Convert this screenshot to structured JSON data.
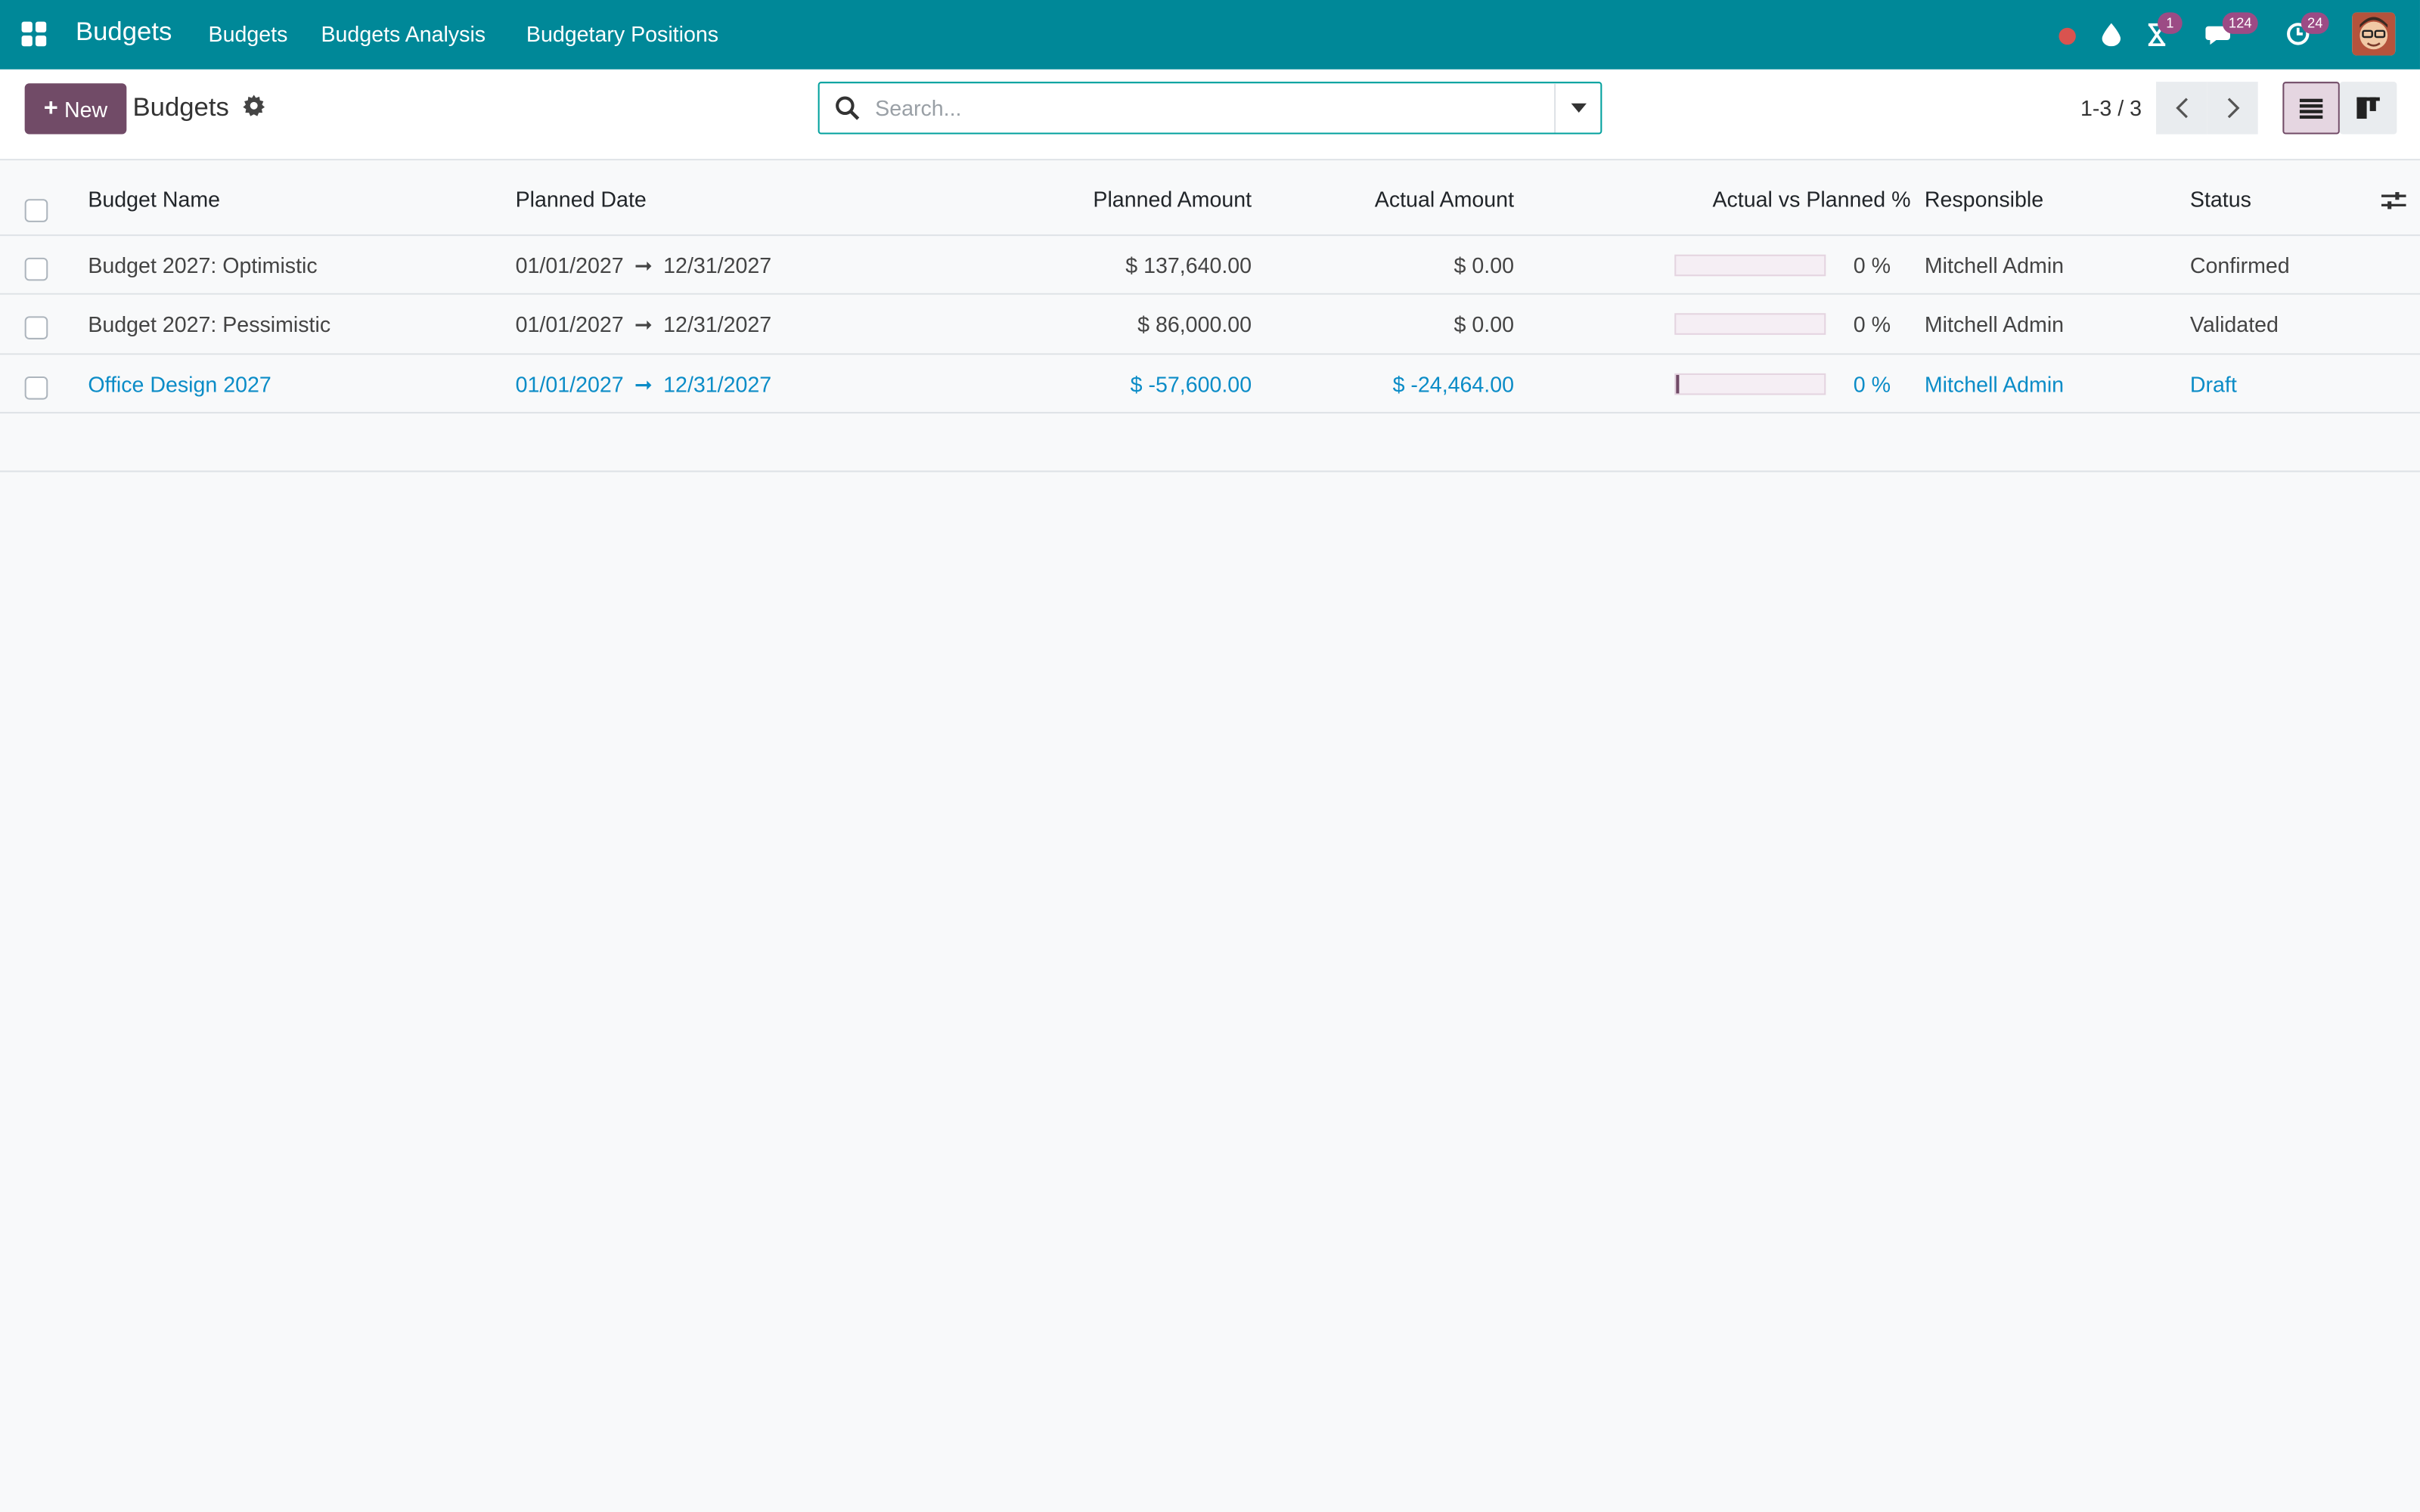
{
  "navbar": {
    "app_name": "Budgets",
    "menus": [
      "Budgets",
      "Budgets Analysis",
      "Budgetary Positions"
    ],
    "activity_badge": "1",
    "messages_badge": "124",
    "updates_badge": "24",
    "color": "#008898"
  },
  "control_panel": {
    "new_label": "New",
    "title": "Budgets",
    "search_placeholder": "Search...",
    "pager": "1-3 / 3"
  },
  "table": {
    "headers": {
      "budget_name": "Budget Name",
      "planned_date": "Planned Date",
      "planned_amount": "Planned Amount",
      "actual_amount": "Actual Amount",
      "actual_vs_planned": "Actual vs Planned %",
      "responsible": "Responsible",
      "status": "Status"
    },
    "rows": [
      {
        "name": "Budget 2027: Optimistic",
        "date_from": "01/01/2027",
        "date_to": "12/31/2027",
        "planned_amount": "$ 137,640.00",
        "actual_amount": "$ 0.00",
        "progress": 0,
        "progress_label": "0 %",
        "responsible": "Mitchell Admin",
        "status": "Confirmed"
      },
      {
        "name": "Budget 2027: Pessimistic",
        "date_from": "01/01/2027",
        "date_to": "12/31/2027",
        "planned_amount": "$ 86,000.00",
        "actual_amount": "$ 0.00",
        "progress": 0,
        "progress_label": "0 %",
        "responsible": "Mitchell Admin",
        "status": "Validated"
      },
      {
        "name": "Office Design 2027",
        "date_from": "01/01/2027",
        "date_to": "12/31/2027",
        "planned_amount": "$ -57,600.00",
        "actual_amount": "$ -24,464.00",
        "progress": 0,
        "progress_label": "0 %",
        "responsible": "Mitchell Admin",
        "status": "Draft"
      }
    ]
  }
}
